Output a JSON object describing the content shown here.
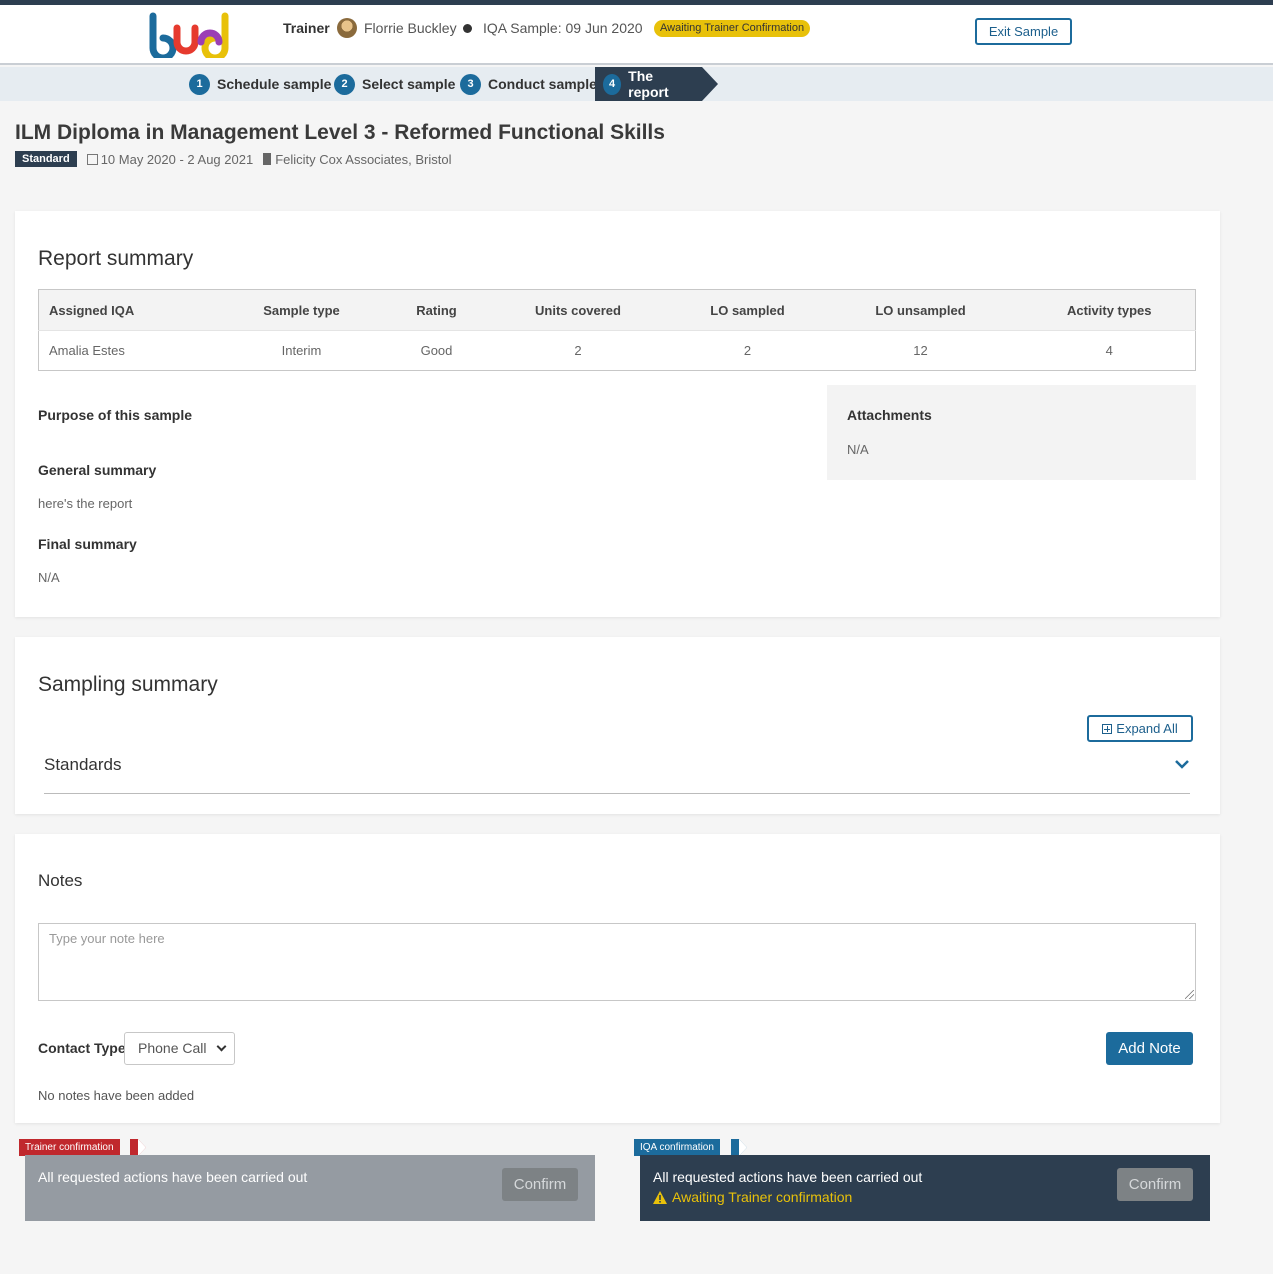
{
  "header": {
    "logo_text": "bud",
    "trainer_label": "Trainer",
    "trainer_name": "Florrie Buckley",
    "iqa_sample": "IQA Sample: 09 Jun 2020",
    "status": "Awaiting Trainer Confirmation",
    "exit_button": "Exit Sample"
  },
  "steps": [
    {
      "num": "1",
      "label": "Schedule sample"
    },
    {
      "num": "2",
      "label": "Select sample"
    },
    {
      "num": "3",
      "label": "Conduct sample"
    },
    {
      "num": "4",
      "label": "The report",
      "active": true
    }
  ],
  "page": {
    "title": "ILM Diploma in Management Level 3 - Reformed Functional Skills",
    "badge": "Standard",
    "dates": "10 May 2020 - 2 Aug 2021",
    "organisation": "Felicity Cox Associates, Bristol"
  },
  "report_summary": {
    "heading": "Report summary",
    "columns": [
      "Assigned IQA",
      "Sample type",
      "Rating",
      "Units covered",
      "LO sampled",
      "LO unsampled",
      "Activity types"
    ],
    "row": [
      "Amalia Estes",
      "Interim",
      "Good",
      "2",
      "2",
      "12",
      "4"
    ],
    "purpose_label": "Purpose of this sample",
    "general_label": "General summary",
    "general_value": "here's the report",
    "final_label": "Final summary",
    "final_value": "N/A",
    "attachments_label": "Attachments",
    "attachments_value": "N/A"
  },
  "sampling_summary": {
    "heading": "Sampling summary",
    "expand_button": "Expand All",
    "standards_label": "Standards"
  },
  "notes": {
    "heading": "Notes",
    "placeholder": "Type your note here",
    "contact_label": "Contact Type",
    "contact_value": "Phone Call",
    "add_button": "Add Note",
    "empty_text": "No notes have been added"
  },
  "trainer_confirmation": {
    "tab": "Trainer confirmation",
    "message": "All requested actions have been carried out",
    "button": "Confirm"
  },
  "iqa_confirmation": {
    "tab": "IQA confirmation",
    "message": "All requested actions have been carried out",
    "warning": "Awaiting Trainer confirmation",
    "button": "Confirm"
  },
  "colors": {
    "primary": "#1c6b9c",
    "dark": "#2d3e50",
    "warning": "#e8c10a",
    "trainer_tab": "#c0282d"
  }
}
